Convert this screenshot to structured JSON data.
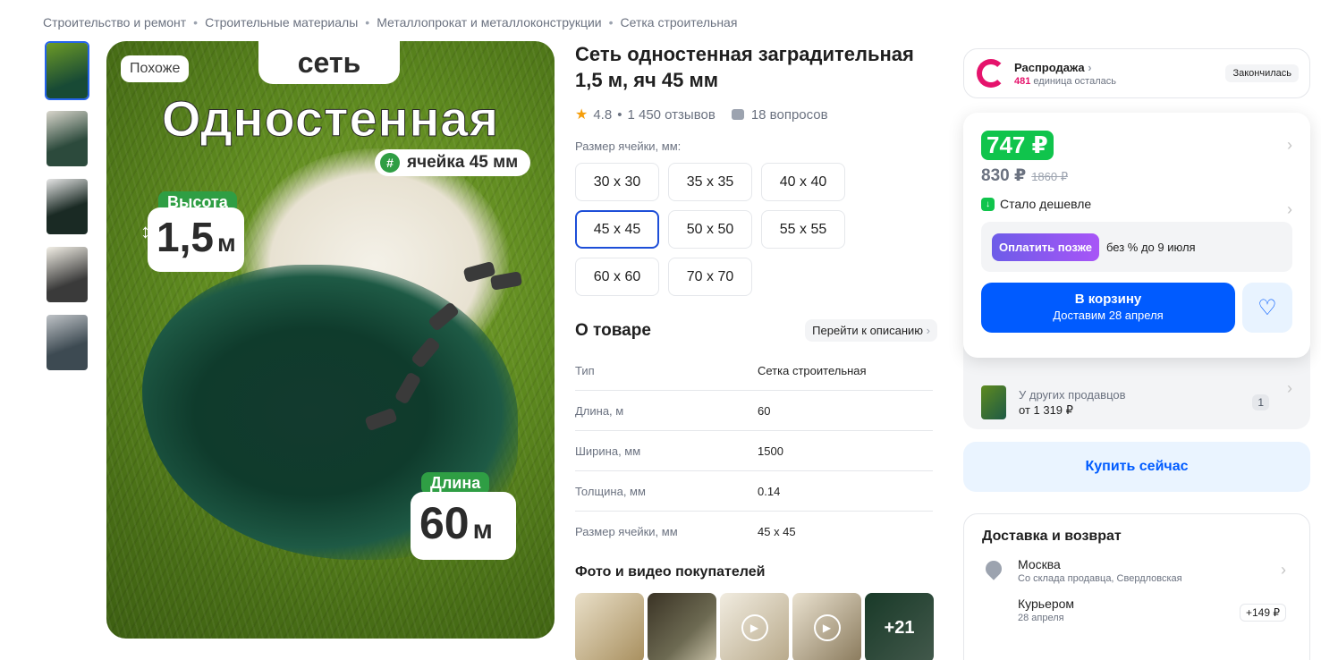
{
  "breadcrumbs": [
    "Строительство и ремонт",
    "Строительные материалы",
    "Металлопрокат и металлоконструкции",
    "Сетка строительная"
  ],
  "image_overlay": {
    "similar_badge": "Похоже",
    "tag_top": "сеть",
    "headline": "Одностенная",
    "cell_pill": "ячейка 45 мм",
    "height_label": "Высота",
    "height_value": "1,5",
    "height_unit": "м",
    "length_label": "Длина",
    "length_value": "60",
    "length_unit": "м"
  },
  "product": {
    "title": "Сеть одностенная заградительная 1,5 м, яч 45 мм",
    "rating": "4.8",
    "reviews": "1 450 отзывов",
    "questions": "18 вопросов",
    "size_label": "Размер ячейки, мм:",
    "sizes": [
      "30 x 30",
      "35 x 35",
      "40 x 40",
      "45 x 45",
      "50 x 50",
      "55 x 55",
      "60 x 60",
      "70 x 70"
    ],
    "selected_size": "45 x 45"
  },
  "about": {
    "title": "О товаре",
    "link": "Перейти к описанию",
    "specs": [
      {
        "key": "Тип",
        "value": "Сетка строительная"
      },
      {
        "key": "Длина, м",
        "value": "60"
      },
      {
        "key": "Ширина, мм",
        "value": "1500"
      },
      {
        "key": "Толщина, мм",
        "value": "0.14"
      },
      {
        "key": "Размер ячейки, мм",
        "value": "45 x 45"
      }
    ]
  },
  "photos": {
    "title": "Фото и видео покупателей",
    "more": "+21"
  },
  "sale": {
    "name": "Распродажа",
    "left_count": "481",
    "left_text": "единица осталась",
    "status": "Закончилась"
  },
  "price": {
    "main": "747 ₽",
    "card": "830 ₽",
    "old": "1860 ₽",
    "cheaper": "Стало дешевле",
    "pay_later_btn": "Оплатить позже",
    "pay_later_text": "без % до 9 июля",
    "cart_label": "В корзину",
    "cart_sub": "Доставим 28 апреля"
  },
  "others": {
    "title": "У других продавцов",
    "price": "от 1 319 ₽",
    "count": "1"
  },
  "buy_now": "Купить сейчас",
  "delivery": {
    "title": "Доставка и возврат",
    "city": "Москва",
    "city_sub": "Со склада продавца, Свердловская",
    "courier": "Курьером",
    "courier_date": "28 апреля",
    "courier_price": "+149 ₽"
  },
  "colors": {
    "accent_blue": "#005bff",
    "price_green": "#10c44c",
    "sale_pink": "#e5136c"
  }
}
